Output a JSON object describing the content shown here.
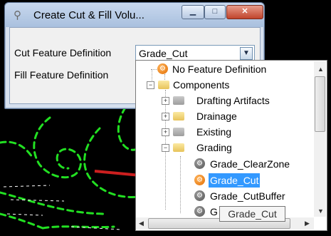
{
  "window": {
    "title": "Create Cut & Fill Volu..."
  },
  "fields": {
    "cut_label": "Cut Feature Definition",
    "cut_value": "Grade_Cut",
    "fill_label": "Fill Feature Definition"
  },
  "tree": {
    "items": [
      {
        "label": "No Feature Definition"
      },
      {
        "label": "Components"
      },
      {
        "label": "Drafting Artifacts"
      },
      {
        "label": "Drainage"
      },
      {
        "label": "Existing"
      },
      {
        "label": "Grading"
      },
      {
        "label": "Grade_ClearZone"
      },
      {
        "label": "Grade_Cut"
      },
      {
        "label": "Grade_CutBuffer"
      },
      {
        "label": "G"
      }
    ]
  },
  "tooltip": {
    "text": "Grade_Cut"
  },
  "colors": {
    "background": "#000000",
    "selection": "#3399ff",
    "arrow": "#cc1f1f",
    "linework": "#22e022"
  }
}
